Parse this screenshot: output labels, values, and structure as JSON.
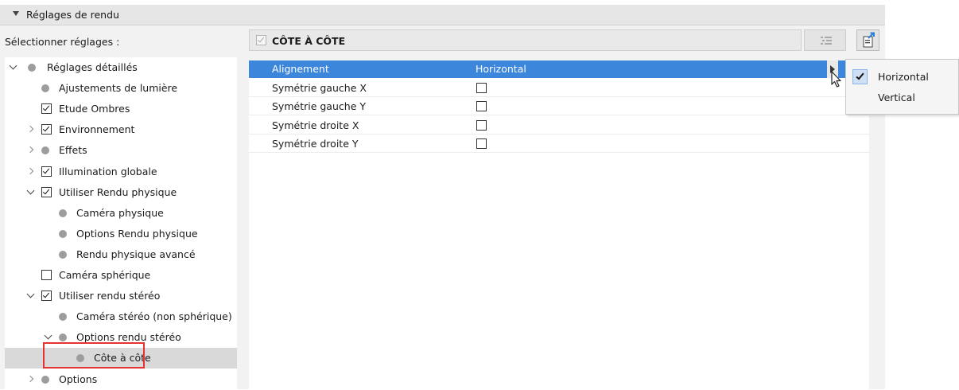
{
  "header": {
    "title": "Réglages de rendu"
  },
  "select_label": "Sélectionner réglages :",
  "tree": [
    {
      "label": "Réglages détaillés",
      "level": 0,
      "expander": "open",
      "marker": "dot"
    },
    {
      "label": "Ajustements de lumière",
      "level": 1,
      "expander": "none",
      "marker": "dot"
    },
    {
      "label": "Etude Ombres",
      "level": 1,
      "expander": "none",
      "marker": "checked"
    },
    {
      "label": "Environnement",
      "level": 1,
      "expander": "closed",
      "marker": "checked"
    },
    {
      "label": "Effets",
      "level": 1,
      "expander": "closed",
      "marker": "dot"
    },
    {
      "label": "Illumination globale",
      "level": 1,
      "expander": "closed",
      "marker": "checked"
    },
    {
      "label": "Utiliser Rendu physique",
      "level": 1,
      "expander": "open",
      "marker": "checked"
    },
    {
      "label": "Caméra physique",
      "level": 2,
      "expander": "none",
      "marker": "dot"
    },
    {
      "label": "Options Rendu physique",
      "level": 2,
      "expander": "none",
      "marker": "dot"
    },
    {
      "label": "Rendu physique avancé",
      "level": 2,
      "expander": "none",
      "marker": "dot"
    },
    {
      "label": "Caméra sphérique",
      "level": 1,
      "expander": "none",
      "marker": "unchecked"
    },
    {
      "label": "Utiliser rendu stéréo",
      "level": 1,
      "expander": "open",
      "marker": "checked"
    },
    {
      "label": "Caméra stéréo (non sphérique)",
      "level": 2,
      "expander": "none",
      "marker": "dot"
    },
    {
      "label": "Options rendu stéréo",
      "level": 2,
      "expander": "open",
      "marker": "dot"
    },
    {
      "label": "Côte à côte",
      "level": 3,
      "expander": "none",
      "marker": "dot",
      "selected": true
    },
    {
      "label": "Options",
      "level": 1,
      "expander": "closed",
      "marker": "dot"
    }
  ],
  "panel": {
    "title": "CÔTE À CÔTE"
  },
  "properties": [
    {
      "name": "Alignement",
      "value": "Horizontal",
      "type": "dropdown",
      "selected": true
    },
    {
      "name": "Symétrie gauche X",
      "type": "checkbox",
      "checked": false
    },
    {
      "name": "Symétrie gauche Y",
      "type": "checkbox",
      "checked": false
    },
    {
      "name": "Symétrie droite X",
      "type": "checkbox",
      "checked": false
    },
    {
      "name": "Symétrie droite Y",
      "type": "checkbox",
      "checked": false
    }
  ],
  "popup": {
    "options": [
      {
        "label": "Horizontal",
        "checked": true
      },
      {
        "label": "Vertical",
        "checked": false
      }
    ]
  },
  "colors": {
    "selection_blue": "#3c86dc",
    "highlight_red": "#e53333"
  }
}
